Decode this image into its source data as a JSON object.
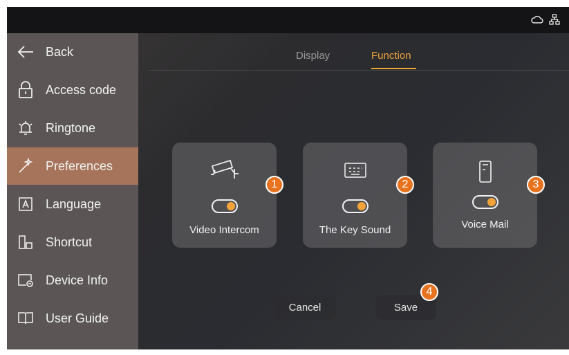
{
  "status_bar": {
    "icons": [
      "cloud-icon",
      "network-icon"
    ]
  },
  "sidebar": {
    "items": [
      {
        "label": "Back",
        "icon": "back-arrow-icon",
        "active": false
      },
      {
        "label": "Access code",
        "icon": "lock-icon",
        "active": false
      },
      {
        "label": "Ringtone",
        "icon": "bell-icon",
        "active": false
      },
      {
        "label": "Preferences",
        "icon": "magic-wand-icon",
        "active": true
      },
      {
        "label": "Language",
        "icon": "language-icon",
        "active": false
      },
      {
        "label": "Shortcut",
        "icon": "shortcut-icon",
        "active": false
      },
      {
        "label": "Device Info",
        "icon": "device-info-icon",
        "active": false
      },
      {
        "label": "User Guide",
        "icon": "book-icon",
        "active": false
      }
    ]
  },
  "tabs": [
    {
      "label": "Display",
      "active": false
    },
    {
      "label": "Function",
      "active": true
    }
  ],
  "cards": [
    {
      "label": "Video Intercom",
      "icon": "camera-icon",
      "toggle_on": true,
      "badge": "1"
    },
    {
      "label": "The Key Sound",
      "icon": "keyboard-icon",
      "toggle_on": true,
      "badge": "2"
    },
    {
      "label": "Voice Mail",
      "icon": "voicemail-icon",
      "toggle_on": true,
      "badge": "3"
    }
  ],
  "buttons": {
    "cancel": "Cancel",
    "save": "Save",
    "save_badge": "4"
  },
  "colors": {
    "accent": "#f2a43a",
    "active_sidebar": "#a6745a",
    "badge": "#e8731e"
  }
}
